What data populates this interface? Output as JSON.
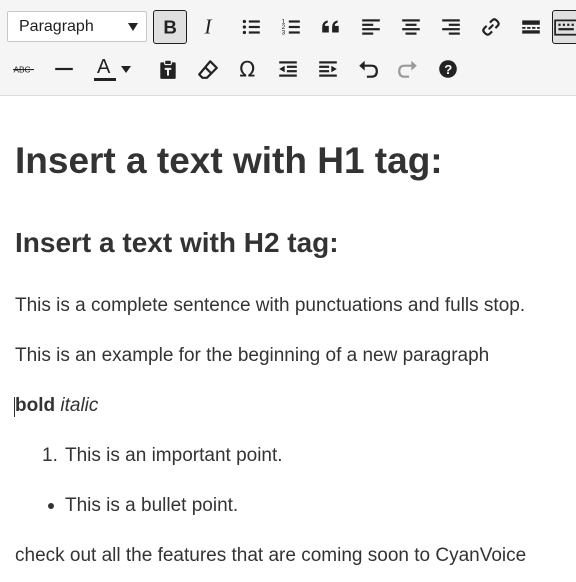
{
  "toolbar": {
    "format_select_value": "Paragraph",
    "color_letter": "A",
    "buttons_row1": [
      "bold",
      "italic",
      "bulleted-list",
      "numbered-list",
      "blockquote",
      "align-left",
      "align-center",
      "align-right",
      "insert-link",
      "read-more",
      "toolbar-toggle"
    ],
    "buttons_row2": [
      "strikethrough",
      "horizontal-line",
      "text-color",
      "paste-as-text",
      "clear-formatting",
      "special-character",
      "decrease-indent",
      "increase-indent",
      "undo",
      "redo",
      "keyboard-shortcuts"
    ],
    "bold_active": true
  },
  "content": {
    "h1": "Insert a text with H1 tag:",
    "h2": "Insert a text with H2 tag:",
    "p1": "This is a complete sentence with punctuations and fulls stop.",
    "p2": "This is an example for the beginning of a new paragraph",
    "bold_text": "bold",
    "italic_text": "italic",
    "ordered_marker": "1.",
    "ordered_item": "This is an important point.",
    "bullet_item": "This is a bullet point.",
    "p4": "check out all the features that are coming soon to CyanVoice"
  }
}
